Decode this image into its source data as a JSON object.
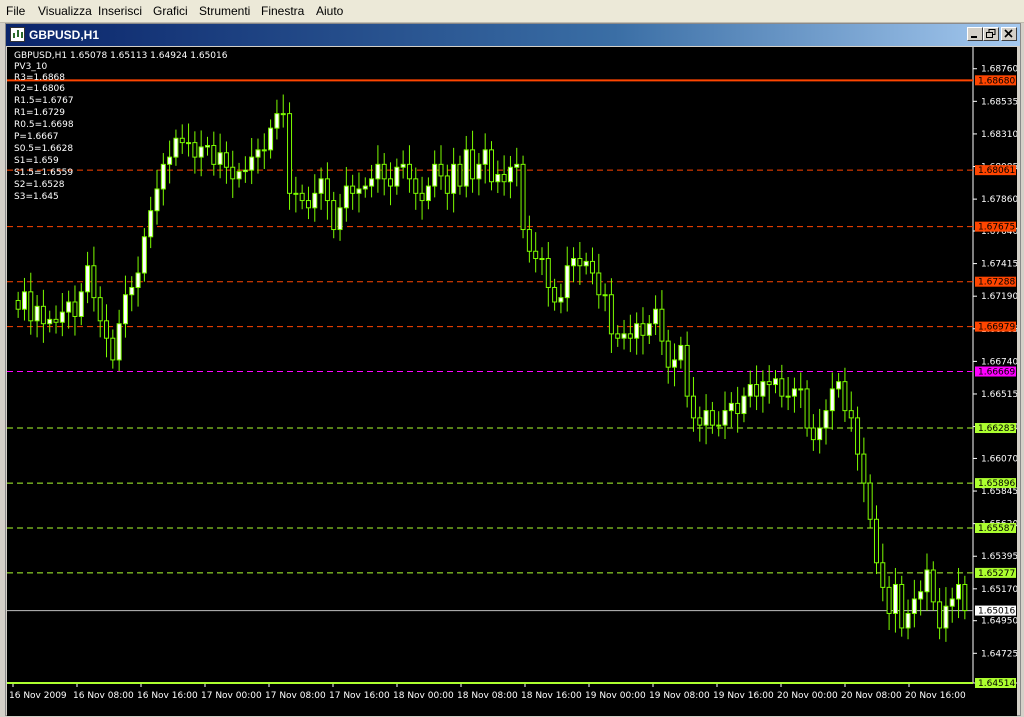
{
  "menu": {
    "items": [
      "File",
      "Visualizza",
      "Inserisci",
      "Grafici",
      "Strumenti",
      "Finestra",
      "Aiuto"
    ]
  },
  "window": {
    "title": "GBPUSD,H1"
  },
  "chart_info": {
    "ohlc_line": "GBPUSD,H1  1.65078 1.65113 1.64924 1.65016",
    "indicator": "PV3_10",
    "levels": [
      "R3=1.6868",
      "R2=1.6806",
      "R1.5=1.6767",
      "R1=1.6729",
      "R0.5=1.6698",
      "P=1.6667",
      "S0.5=1.6628",
      "S1=1.659",
      "S1.5=1.6559",
      "S2=1.6528",
      "S3=1.645"
    ]
  },
  "colors": {
    "background": "#000000",
    "bull_candle": "#ffffff",
    "wick": "#7CFC00",
    "resistance": "#ff4500",
    "pivot": "#ff00ff",
    "support": "#adff2f",
    "current_price": "#c0c0c0"
  },
  "chart_data": {
    "type": "candlestick",
    "symbol": "GBPUSD",
    "timeframe": "H1",
    "ylim": [
      1.6452,
      1.6891
    ],
    "y_ticks": [
      "1.68760",
      "1.68535",
      "1.68310",
      "1.68085",
      "1.67860",
      "1.67640",
      "1.67415",
      "1.67190",
      "1.66965",
      "1.66740",
      "1.66515",
      "1.66290",
      "1.66070",
      "1.65845",
      "1.65620",
      "1.65395",
      "1.65170",
      "1.64950",
      "1.64725"
    ],
    "x_ticks": [
      "16 Nov 2009",
      "16 Nov 08:00",
      "16 Nov 16:00",
      "17 Nov 00:00",
      "17 Nov 08:00",
      "17 Nov 16:00",
      "18 Nov 00:00",
      "18 Nov 08:00",
      "18 Nov 16:00",
      "19 Nov 00:00",
      "19 Nov 08:00",
      "19 Nov 16:00",
      "20 Nov 00:00",
      "20 Nov 08:00",
      "20 Nov 16:00"
    ],
    "horizontal_lines": [
      {
        "value": 1.6868,
        "label": "1.68680",
        "color": "#ff4500",
        "style": "solid"
      },
      {
        "value": 1.6806,
        "label": "1.68061",
        "color": "#ff4500",
        "style": "dash"
      },
      {
        "value": 1.6767,
        "label": "1.67675",
        "color": "#ff4500",
        "style": "dash"
      },
      {
        "value": 1.6729,
        "label": "1.67288",
        "color": "#ff4500",
        "style": "dash"
      },
      {
        "value": 1.6698,
        "label": "1.66979",
        "color": "#ff4500",
        "style": "dash"
      },
      {
        "value": 1.6667,
        "label": "1.66669",
        "color": "#ff00ff",
        "style": "dash"
      },
      {
        "value": 1.6628,
        "label": "1.66283",
        "color": "#adff2f",
        "style": "dash"
      },
      {
        "value": 1.659,
        "label": "1.65896",
        "color": "#adff2f",
        "style": "dash"
      },
      {
        "value": 1.6559,
        "label": "1.65587",
        "color": "#adff2f",
        "style": "dash"
      },
      {
        "value": 1.6528,
        "label": "1.65277",
        "color": "#adff2f",
        "style": "dash"
      },
      {
        "value": 1.6502,
        "label": "1.65016",
        "color": "#c0c0c0",
        "style": "solid"
      },
      {
        "value": 1.6452,
        "label": "1.64514",
        "color": "#adff2f",
        "style": "solid"
      }
    ],
    "closes": [
      1.671,
      1.6722,
      1.6702,
      1.6712,
      1.67,
      1.6703,
      1.6701,
      1.6708,
      1.6715,
      1.6705,
      1.6722,
      1.674,
      1.6718,
      1.6702,
      1.669,
      1.6675,
      1.67,
      1.672,
      1.6725,
      1.6735,
      1.676,
      1.6778,
      1.6793,
      1.681,
      1.6815,
      1.6828,
      1.6825,
      1.6825,
      1.6815,
      1.6822,
      1.6823,
      1.681,
      1.6818,
      1.6808,
      1.68,
      1.6805,
      1.6806,
      1.6815,
      1.682,
      1.682,
      1.6835,
      1.6845,
      1.6845,
      1.679,
      1.679,
      1.6785,
      1.678,
      1.679,
      1.68,
      1.6785,
      1.6765,
      1.678,
      1.6795,
      1.679,
      1.6793,
      1.6795,
      1.68,
      1.681,
      1.68,
      1.6795,
      1.6808,
      1.681,
      1.68,
      1.679,
      1.6785,
      1.6795,
      1.681,
      1.6802,
      1.679,
      1.681,
      1.6795,
      1.682,
      1.68,
      1.681,
      1.682,
      1.6798,
      1.6803,
      1.6798,
      1.6808,
      1.681,
      1.6765,
      1.675,
      1.6745,
      1.6745,
      1.6725,
      1.6715,
      1.6718,
      1.674,
      1.6745,
      1.674,
      1.6743,
      1.6735,
      1.672,
      1.672,
      1.6693,
      1.669,
      1.6693,
      1.669,
      1.67,
      1.6692,
      1.67,
      1.671,
      1.6688,
      1.667,
      1.6675,
      1.6685,
      1.665,
      1.6635,
      1.663,
      1.664,
      1.663,
      1.663,
      1.664,
      1.6645,
      1.6638,
      1.665,
      1.6658,
      1.665,
      1.666,
      1.6658,
      1.6662,
      1.665,
      1.665,
      1.6655,
      1.6655,
      1.6628,
      1.662,
      1.6628,
      1.664,
      1.6655,
      1.666,
      1.664,
      1.6635,
      1.661,
      1.659,
      1.6565,
      1.6535,
      1.6518,
      1.65,
      1.652,
      1.649,
      1.65,
      1.651,
      1.6515,
      1.653,
      1.6508,
      1.649,
      1.6505,
      1.651,
      1.652,
      1.6502
    ]
  },
  "chart_labels": {
    "y_tick_labels": [
      "1.68760",
      "1.68535",
      "1.68310",
      "1.68085",
      "1.67860",
      "1.67640",
      "1.67415",
      "1.67190",
      "1.66965",
      "1.66740",
      "1.66515",
      "1.66290",
      "1.66070",
      "1.65845",
      "1.65620",
      "1.65395",
      "1.65170",
      "1.64950",
      "1.64725"
    ],
    "x_tick_labels": [
      "16 Nov 2009",
      "16 Nov 08:00",
      "16 Nov 16:00",
      "17 Nov 00:00",
      "17 Nov 08:00",
      "17 Nov 16:00",
      "18 Nov 00:00",
      "18 Nov 08:00",
      "18 Nov 16:00",
      "19 Nov 00:00",
      "19 Nov 08:00",
      "19 Nov 16:00",
      "20 Nov 00:00",
      "20 Nov 08:00",
      "20 Nov 16:00"
    ]
  }
}
